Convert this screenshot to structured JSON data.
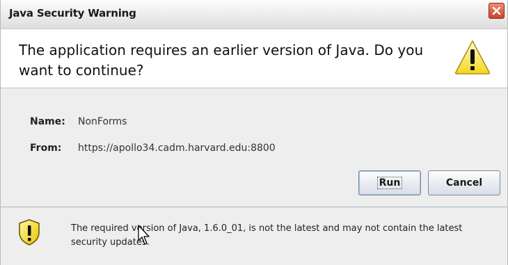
{
  "window": {
    "title": "Java Security Warning",
    "close_icon": "close-icon"
  },
  "header": {
    "message": "The application requires an earlier version of Java.  Do you want to continue?",
    "icon": "warning-triangle-icon"
  },
  "details": {
    "name_label": "Name:",
    "name_value": "NonForms",
    "from_label": "From:",
    "from_value": "https://apollo34.cadm.harvard.edu:8800"
  },
  "buttons": {
    "run_label": "Run",
    "cancel_label": "Cancel"
  },
  "footer": {
    "icon": "shield-warning-icon",
    "message": "The required version of Java, 1.6.0_01, is not the latest and may not contain the latest security updates."
  },
  "colors": {
    "title_bar": "#e8e8e8",
    "close_button": "#d9593f",
    "warning_yellow": "#f7e33a",
    "divider": "#a9b4c6"
  }
}
